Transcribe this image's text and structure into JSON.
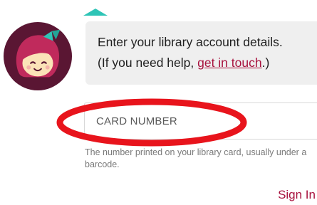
{
  "colors": {
    "accent": "#a8123e",
    "teal": "#2ec4b6",
    "avatar_bg": "#5a1633",
    "annotation": "#e8141c"
  },
  "prompt": {
    "line1": "Enter your library account details.",
    "line2_prefix": "(If you need help, ",
    "link_text": "get in touch",
    "line2_suffix": ".)"
  },
  "card_field": {
    "placeholder": "CARD NUMBER",
    "value": "",
    "help": "The number printed on your library card, usually under a barcode."
  },
  "actions": {
    "sign_in": "Sign In"
  },
  "icons": {
    "avatar": "libby-character-avatar-icon",
    "pointer": "teal-caret-up-icon"
  }
}
